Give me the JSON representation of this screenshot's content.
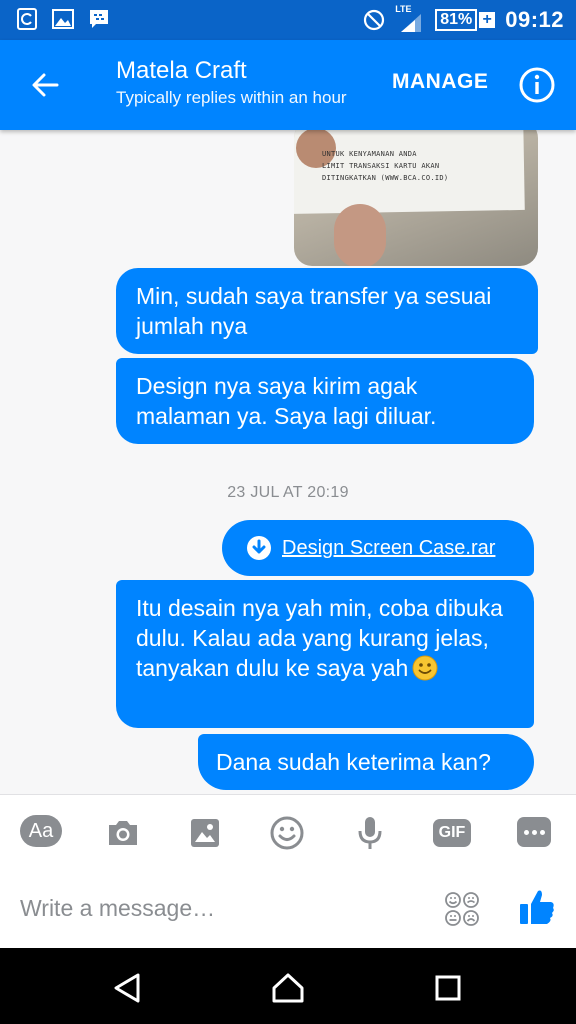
{
  "status_bar": {
    "lte": "LTE",
    "battery": "81%",
    "battery_plus": "+",
    "time": "09:12"
  },
  "header": {
    "title": "Matela Craft",
    "subtitle": "Typically replies within an hour",
    "manage": "MANAGE"
  },
  "photo": {
    "lines": [
      "UNTUK KENYAMANAN ANDA",
      "LIMIT TRANSAKSI KARTU AKAN",
      "DITINGKATKAN (WWW.BCA.CO.ID)"
    ]
  },
  "messages": [
    {
      "text": "Min, sudah saya transfer ya sesuai jumlah nya"
    },
    {
      "text": "Design nya saya kirim agak malaman ya. Saya lagi diluar."
    },
    {
      "text": "Itu desain nya yah min, coba dibuka dulu. Kalau ada yang kurang jelas, tanyakan dulu ke saya yah"
    },
    {
      "text": "Dana sudah keterima kan?"
    }
  ],
  "timestamp": "23 JUL AT 20:19",
  "attachment": {
    "name": "Design Screen Case.rar"
  },
  "composer": {
    "aa_label": "Aa",
    "gif_label": "GIF",
    "placeholder": "Write a message…"
  },
  "colors": {
    "header": "#0084ff",
    "status_bar": "#0a64c8",
    "bubble": "#0084ff",
    "tool_grey": "#8a8d91"
  }
}
